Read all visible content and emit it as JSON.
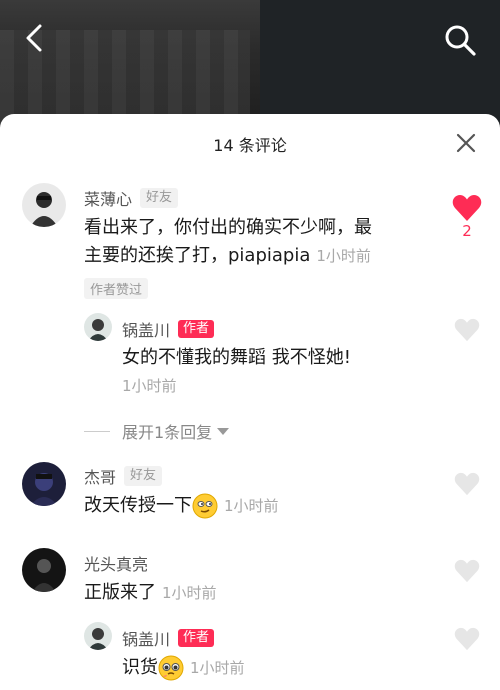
{
  "header": {
    "title": "14 条评论"
  },
  "comments": [
    {
      "name": "菜薄心",
      "badge": "好友",
      "text_line1": "看出来了，你付出的确实不少啊，最",
      "text_line2": "主要的还挨了打，piapiapia",
      "time": "1小时前",
      "author_liked": "作者赞过",
      "likes": "2",
      "liked": true,
      "replies": [
        {
          "name": "锅盖川",
          "badge": "作者",
          "text": "女的不懂我的舞蹈 我不怪她!",
          "time": "1小时前"
        }
      ],
      "expand_label": "展开1条回复"
    },
    {
      "name": "杰哥",
      "badge": "好友",
      "text": "改天传授一下",
      "emoji": "smirk-emoji",
      "time": "1小时前"
    },
    {
      "name": "光头真亮",
      "text": "正版来了",
      "time": "1小时前",
      "replies": [
        {
          "name": "锅盖川",
          "badge": "作者",
          "text": "识货",
          "emoji": "pleading-emoji",
          "time": "1小时前"
        }
      ]
    }
  ],
  "colors": {
    "accent": "#fe2c55",
    "like_empty": "#e6e6e6"
  },
  "icons": {
    "back": "chevron-left-icon",
    "search": "search-icon",
    "close": "close-icon",
    "like": "heart-icon"
  }
}
